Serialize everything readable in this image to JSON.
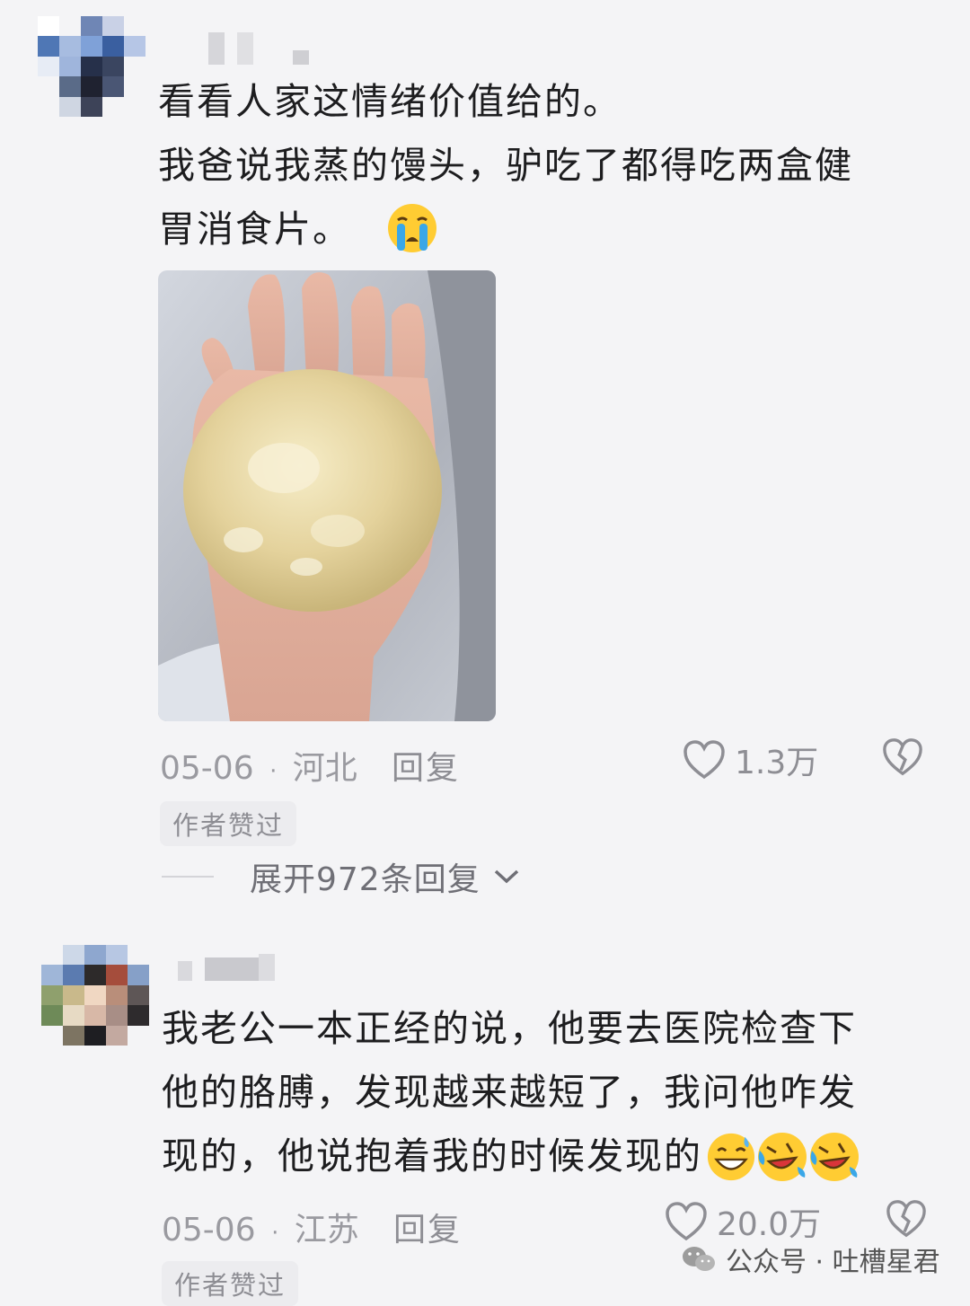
{
  "comments": [
    {
      "text_lines": [
        "看看人家这情绪价值给的。",
        "我爸说我蒸的馒头，驴吃了都得吃两盒健",
        "胃消食片。"
      ],
      "emoji": "loudly-crying-face-icon",
      "image": "steamed-bun-in-hand-photo",
      "date": "05-06",
      "sep": "·",
      "location": "河北",
      "reply_label": "回复",
      "likes": "1.3万",
      "author_liked": "作者赞过",
      "expand_label": "展开972条回复"
    },
    {
      "text_lines": [
        "我老公一本正经的说，他要去医院检查下",
        "他的胳膊，发现越来越短了，我问他咋发",
        "现的，他说抱着我的时候发现的"
      ],
      "emojis": [
        "grinning-sweat-face-icon",
        "rolling-laughing-face-icon",
        "rolling-laughing-face-icon"
      ],
      "date": "05-06",
      "sep": "·",
      "location": "江苏",
      "reply_label": "回复",
      "likes": "20.0万",
      "author_liked": "作者赞过"
    }
  ],
  "watermark": {
    "icon": "wechat-icon",
    "text": "公众号 · 吐槽星君"
  },
  "colors": {
    "background": "#f4f4f6",
    "text": "#1d1d1f",
    "meta": "#9a9aa0"
  }
}
